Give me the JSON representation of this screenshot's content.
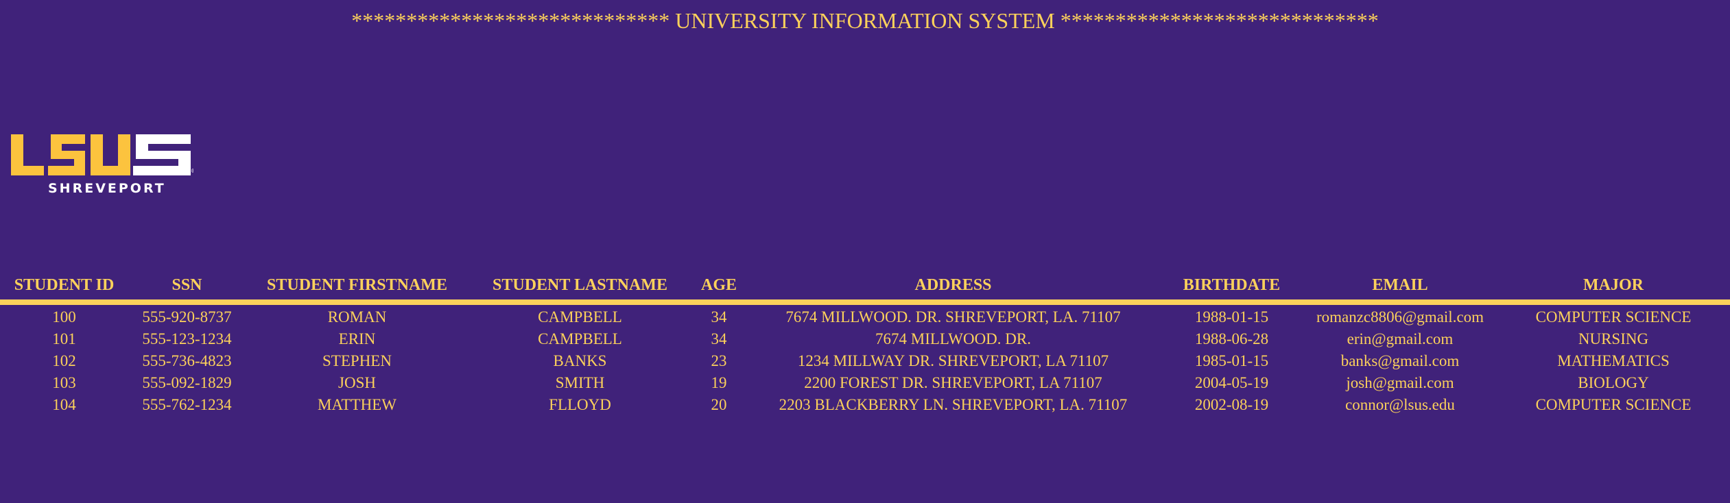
{
  "banner": {
    "left_stars": "*****************************",
    "title": "UNIVERSITY INFORMATION SYSTEM",
    "right_stars": "*****************************"
  },
  "logo": {
    "wordmark": "LSUS",
    "subtitle": "SHREVEPORT",
    "colors": {
      "gold": "#fcc33e",
      "white": "#ffffff"
    }
  },
  "colors": {
    "background": "#40227a",
    "text": "#fcd15b"
  },
  "table": {
    "headers": {
      "student_id": "STUDENT ID",
      "ssn": "SSN",
      "firstname": "STUDENT FIRSTNAME",
      "lastname": "STUDENT LASTNAME",
      "age": "AGE",
      "address": "ADDRESS",
      "birthdate": "BIRTHDATE",
      "email": "EMAIL",
      "major": "MAJOR"
    },
    "rows": [
      {
        "student_id": "100",
        "ssn": "555-920-8737",
        "firstname": "ROMAN",
        "lastname": "CAMPBELL",
        "age": "34",
        "address": "7674 MILLWOOD. DR. SHREVEPORT, LA. 71107",
        "birthdate": "1988-01-15",
        "email": "romanzc8806@gmail.com",
        "major": "COMPUTER SCIENCE"
      },
      {
        "student_id": "101",
        "ssn": "555-123-1234",
        "firstname": "ERIN",
        "lastname": "CAMPBELL",
        "age": "34",
        "address": "7674 MILLWOOD. DR.",
        "birthdate": "1988-06-28",
        "email": "erin@gmail.com",
        "major": "NURSING"
      },
      {
        "student_id": "102",
        "ssn": "555-736-4823",
        "firstname": "STEPHEN",
        "lastname": "BANKS",
        "age": "23",
        "address": "1234 MILLWAY DR. SHREVEPORT, LA 71107",
        "birthdate": "1985-01-15",
        "email": "banks@gmail.com",
        "major": "MATHEMATICS"
      },
      {
        "student_id": "103",
        "ssn": "555-092-1829",
        "firstname": "JOSH",
        "lastname": "SMITH",
        "age": "19",
        "address": "2200 FOREST DR. SHREVEPORT, LA 71107",
        "birthdate": "2004-05-19",
        "email": "josh@gmail.com",
        "major": "BIOLOGY"
      },
      {
        "student_id": "104",
        "ssn": "555-762-1234",
        "firstname": "MATTHEW",
        "lastname": "FLLOYD",
        "age": "20",
        "address": "2203 BLACKBERRY LN. SHREVEPORT, LA. 71107",
        "birthdate": "2002-08-19",
        "email": "connor@lsus.edu",
        "major": "COMPUTER SCIENCE"
      }
    ]
  }
}
